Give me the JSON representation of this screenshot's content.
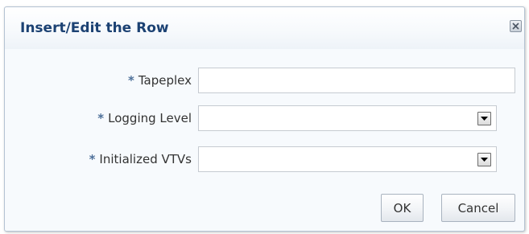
{
  "dialog": {
    "title": "Insert/Edit the Row",
    "close_icon": "close-icon"
  },
  "form": {
    "required_marker": "*",
    "fields": [
      {
        "label": "Tapeplex",
        "type": "text",
        "value": ""
      },
      {
        "label": "Logging Level",
        "type": "select",
        "value": "",
        "icon": "chevron-down-icon"
      },
      {
        "label": "Initialized VTVs",
        "type": "select",
        "value": "",
        "icon": "chevron-down-icon"
      }
    ]
  },
  "buttons": {
    "ok_label": "OK",
    "cancel_label": "Cancel"
  },
  "colors": {
    "title": "#1c4273",
    "required_marker": "#4d6f99",
    "label": "#333333",
    "dialog_background": "#f7fafd",
    "border": "#b4c3d3"
  }
}
